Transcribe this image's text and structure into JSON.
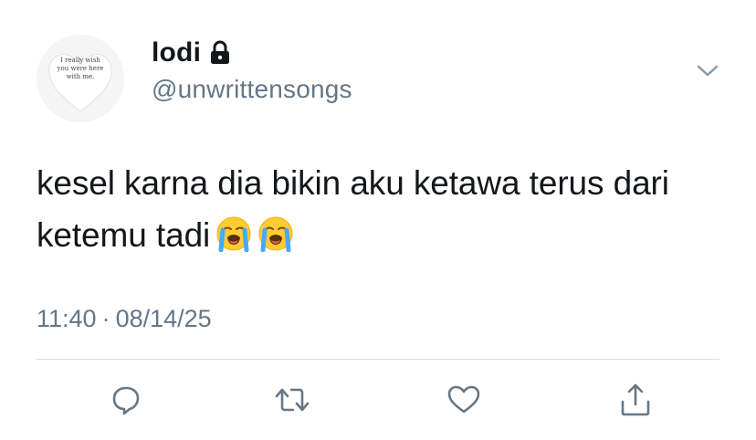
{
  "user": {
    "display_name": "lodi",
    "handle": "@unwrittensongs",
    "avatar_text": "I really wish\nyou were here\nwith me."
  },
  "tweet": {
    "text": "kesel karna dia bikin aku ketawa terus dari ketemu tadi",
    "emojis": [
      "loudly-crying-face",
      "loudly-crying-face"
    ]
  },
  "meta": {
    "time": "11:40",
    "separator": "·",
    "date": "08/14/25"
  },
  "icons": {
    "lock": "lock-icon",
    "caret": "chevron-down-icon",
    "reply": "reply-icon",
    "retweet": "retweet-icon",
    "like": "heart-icon",
    "share": "share-icon"
  },
  "colors": {
    "text_primary": "#14171a",
    "text_secondary": "#657786",
    "divider": "#d9dee2",
    "icon": "#657786"
  }
}
